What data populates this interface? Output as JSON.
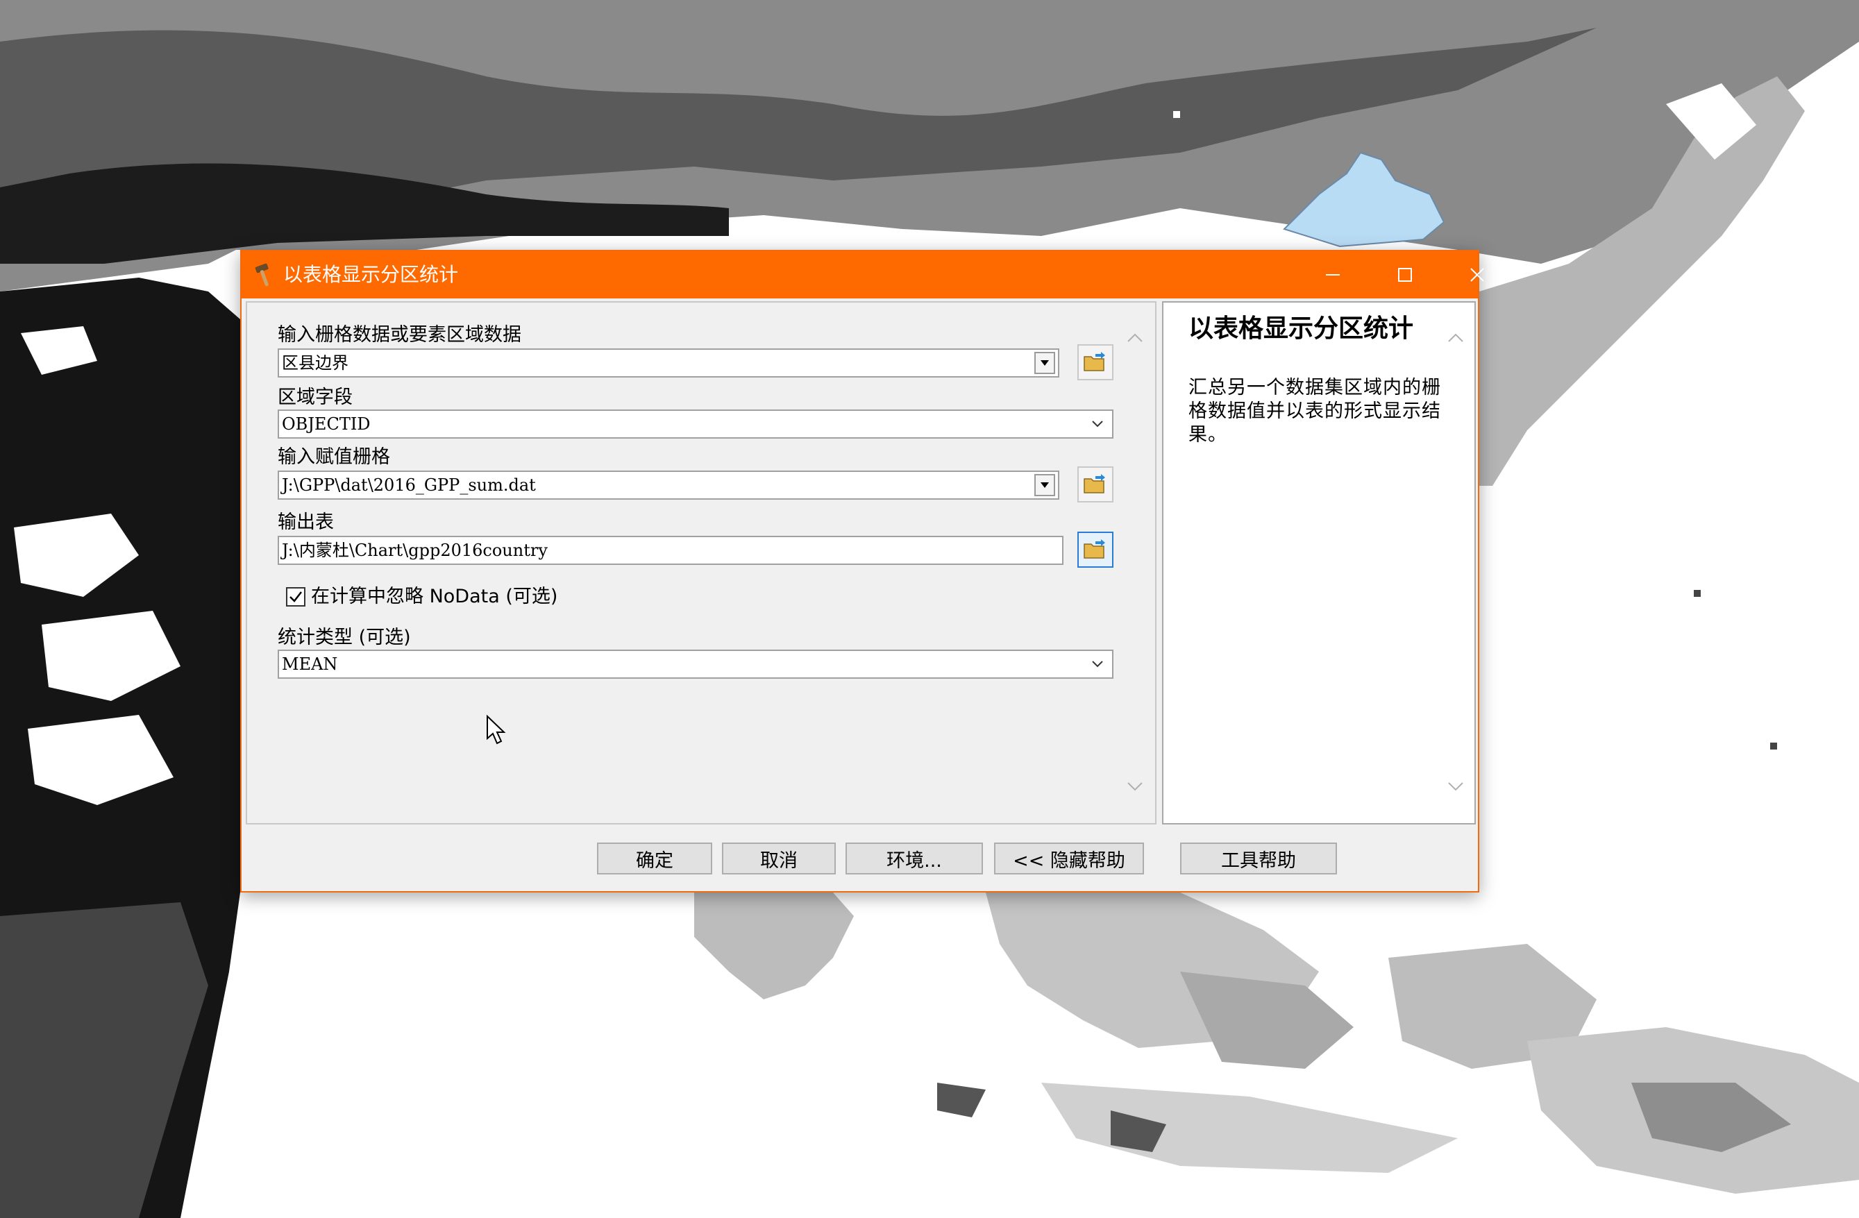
{
  "window": {
    "title": "以表格显示分区统计",
    "title_icon": "hammer-icon",
    "controls": [
      "minimize-icon",
      "maximize-icon",
      "close-icon"
    ]
  },
  "form": {
    "zone_input": {
      "label": "输入栅格数据或要素区域数据",
      "value": "区县边界"
    },
    "zone_field": {
      "label": "区域字段",
      "value": "OBJECTID"
    },
    "value_raster": {
      "label": "输入赋值栅格",
      "value": "J:\\GPP\\dat\\2016_GPP_sum.dat"
    },
    "output_table": {
      "label": "输出表",
      "value": "J:\\内蒙杜\\Chart\\gpp2016country"
    },
    "ignore_nodata": {
      "label": "在计算中忽略 NoData (可选)",
      "checked": true
    },
    "statistics_type": {
      "label": "统计类型 (可选)",
      "value": "MEAN"
    }
  },
  "help": {
    "title": "以表格显示分区统计",
    "body": "汇总另一个数据集区域内的栅格数据值并以表的形式显示结果。"
  },
  "buttons": {
    "ok": "确定",
    "cancel": "取消",
    "environments": "环境...",
    "hide_help": "<< 隐藏帮助",
    "tool_help": "工具帮助"
  },
  "colors": {
    "titlebar": "#ff6a00",
    "dialog_bg": "#f0f0f0",
    "map_highlight": "#b9dcf5"
  }
}
